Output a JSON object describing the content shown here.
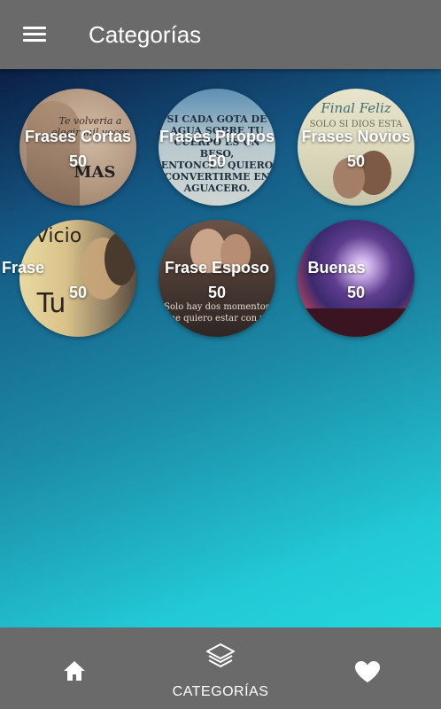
{
  "app_bar": {
    "title": "Categorías"
  },
  "categories": [
    {
      "name": "Frases Cortas",
      "count": "50",
      "image_text": "Te volveria a elegir... veces MAS"
    },
    {
      "name": "Frases Piropos",
      "count": "50",
      "image_text": "SI CADA GOTA DE AGUA SOBRE TU CUERPO ES UN BESO, ENTONCES QUIERO CONVERTIRME EN AGUACERO."
    },
    {
      "name": "Frases Novios",
      "count": "50",
      "image_text": "Final Feliz: SOLO SI DIOS ESTA"
    },
    {
      "name": "Frase",
      "count": "50",
      "image_text": "Vicio Tu"
    },
    {
      "name": "Frase Esposo",
      "count": "50",
      "image_text": "Solo hay dos momentos que quiero estar con ve"
    },
    {
      "name": "Buenas",
      "count": "50",
      "image_text": ""
    }
  ],
  "bottom_nav": {
    "items": [
      {
        "id": "home",
        "label": "",
        "icon": "home-icon"
      },
      {
        "id": "categories",
        "label": "CATEGORÍAS",
        "icon": "layers-icon",
        "active": true
      },
      {
        "id": "favorites",
        "label": "",
        "icon": "heart-icon"
      }
    ]
  }
}
